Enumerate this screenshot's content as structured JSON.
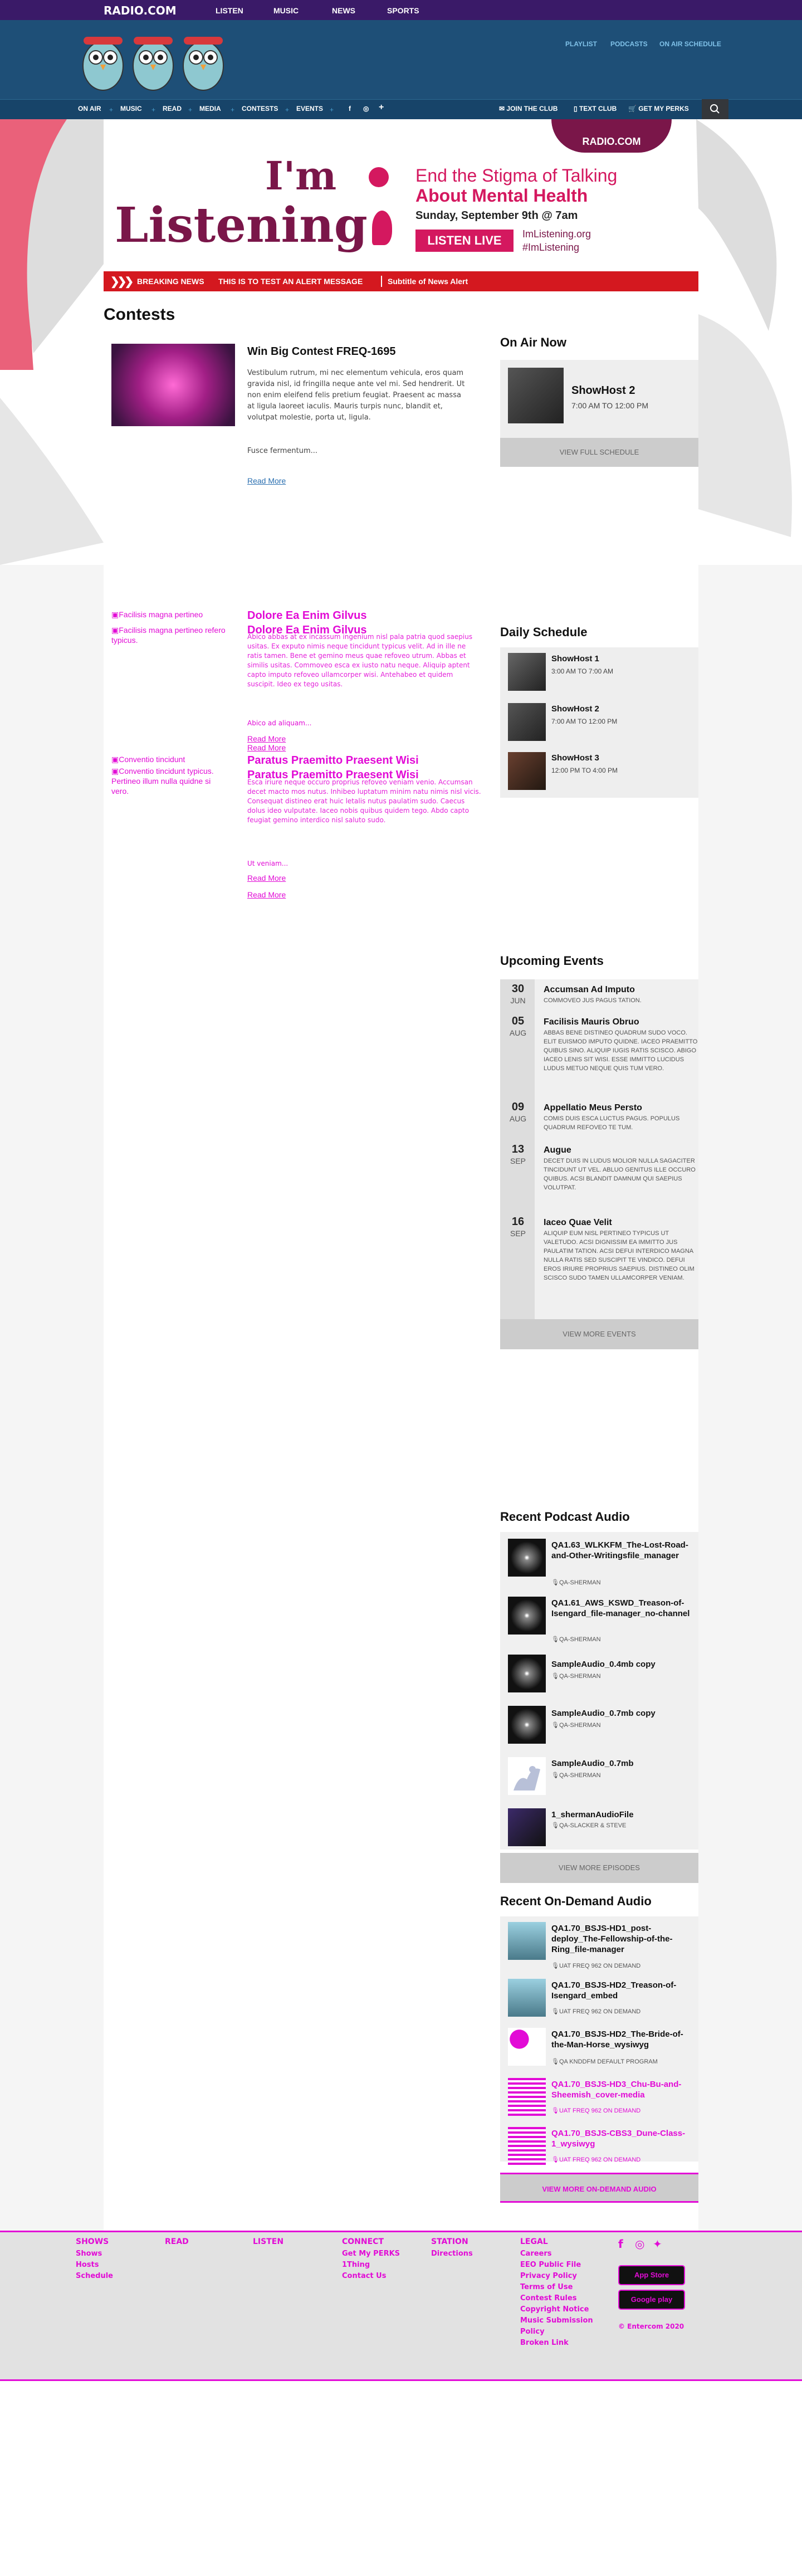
{
  "top": {
    "logo": "RADIO.COM",
    "nav": [
      "LISTEN",
      "MUSIC",
      "NEWS",
      "SPORTS"
    ]
  },
  "header": {
    "links": [
      "PLAYLIST",
      "PODCASTS",
      "ON AIR SCHEDULE"
    ]
  },
  "nav": {
    "items": [
      "ON AIR",
      "MUSIC",
      "READ",
      "MEDIA",
      "CONTESTS",
      "EVENTS"
    ],
    "right": [
      "JOIN THE CLUB",
      "TEXT CLUB",
      "GET MY PERKS"
    ]
  },
  "banner": {
    "radio": "RADIO.COM",
    "im": "I'm",
    "listening": "Listening",
    "end1": "End the Stigma of Talking",
    "end2": "About Mental Health",
    "date": "Sunday, September 9th @ 7am",
    "live": "LISTEN LIVE",
    "url": "ImListening.org",
    "hash": "#ImListening"
  },
  "alert": {
    "label": "BREAKING NEWS",
    "msg": "THIS IS TO TEST AN ALERT MESSAGE",
    "sub": "Subtitle of News Alert"
  },
  "page_title": "Contests",
  "contests": [
    {
      "title": "Win Big Contest FREQ-1695",
      "body": "Vestibulum rutrum, mi nec elementum vehicula, eros quam gravida nisl, id fringilla neque ante vel mi. Sed hendrerit. Ut non enim eleifend felis pretium feugiat. Praesent ac massa at ligula laoreet iaculis. Mauris turpis nunc, blandit et, volutpat molestie, porta ut, ligula.",
      "body2": "Fusce fermentum...",
      "read_more": "Read More"
    }
  ],
  "broken1": {
    "alt1": "Facilisis magna pertineo",
    "alt2": "Facilisis magna pertineo refero typicus.",
    "t1": "Dolore Ea Enim Gilvus",
    "t2": "Dolore Ea Enim Gilvus",
    "b1": "Abico abbas at ex incassum ingenium nisl pala patria quod saepius usitas. Ex exputo nimis neque tincidunt typicus velit. Ad in ille ne ratis tamen. Bene et gemino meus quae refoveo utrum. Abbas et similis usitas. Commoveo esca ex iusto natu neque. Aliquip aptent capto imputo refoveo ullamcorper wisi. Antehabeo et quidem suscipit. Ideo ex tego usitas.",
    "b2": "Abico ad aliquam...",
    "rm1": "Read More",
    "rm2": "Read More"
  },
  "broken2": {
    "alt1": "Conventio tincidunt",
    "alt2": "Conventio tincidunt typicus. Pertineo illum nulla quidne si vero.",
    "t1": "Paratus Praemitto Praesent Wisi",
    "t2": "Paratus Praemitto Praesent Wisi",
    "b1": "Esca iriure neque occuro proprius refoveo veniam venio. Accumsan decet macto mos nutus. Inhibeo luptatum minim natu nimis nisl vicis. Consequat distineo erat huic letalis nutus paulatim sudo. Caecus dolus ideo vulputate. Iaceo nobis quibus quidem tego. Abdo capto feugiat gemino interdico nisl saluto sudo.",
    "b2": "Ut veniam...",
    "rm1": "Read More",
    "rm2": "Read More"
  },
  "onair": {
    "heading": "On Air Now",
    "show": "ShowHost 2",
    "time": "7:00 AM TO 12:00 PM",
    "btn": "VIEW FULL SCHEDULE"
  },
  "schedule": {
    "heading": "Daily Schedule",
    "items": [
      {
        "name": "ShowHost 1",
        "time": "3:00 AM TO 7:00 AM"
      },
      {
        "name": "ShowHost 2",
        "time": "7:00 AM TO 12:00 PM"
      },
      {
        "name": "ShowHost 3",
        "time": "12:00 PM TO 4:00 PM"
      }
    ]
  },
  "events": {
    "heading": "Upcoming Events",
    "items": [
      {
        "day": "30",
        "mon": "JUN",
        "title": "Accumsan Ad Imputo",
        "desc": "Commoveo jus pagus tation."
      },
      {
        "day": "05",
        "mon": "AUG",
        "title": "Facilisis Mauris Obruo",
        "desc": "Abbas bene distineo quadrum sudo voco. Elit euismod imputo quidne. Iaceo praemitto quibus sino. Aliquip iugis ratis scisco. Abigo iaceo lenis sit wisi. Esse immitto lucidus ludus metuo neque quis tum vero."
      },
      {
        "day": "09",
        "mon": "AUG",
        "title": "Appellatio Meus Persto",
        "desc": "Comis duis esca luctus pagus. Populus quadrum refoveo te tum."
      },
      {
        "day": "13",
        "mon": "SEP",
        "title": "Augue",
        "desc": "Decet duis in ludus molior nulla sagaciter tincidunt ut vel. Abluo genitus ille occuro quibus. Acsi blandit damnum qui saepius volutpat."
      },
      {
        "day": "16",
        "mon": "SEP",
        "title": "Iaceo Quae Velit",
        "desc": "Aliquip eum nisl pertineo typicus ut valetudo. Acsi dignissim ea immitto jus paulatim tation. Acsi defui interdico magna nulla ratis sed suscipit te vindico. Defui eros iriure proprius saepius. Distineo olim scisco sudo tamen ullamcorper veniam."
      }
    ],
    "btn": "VIEW MORE EVENTS"
  },
  "podcasts": {
    "heading": "Recent Podcast Audio",
    "items": [
      {
        "title": "QA1.63_WLKKFM_The-Lost-Road-and-Other-Writingsfile_manager",
        "sub": "QA-SHERMAN"
      },
      {
        "title": "QA1.61_AWS_KSWD_Treason-of-Isengard_file-manager_no-channel",
        "sub": "QA-SHERMAN"
      },
      {
        "title": "SampleAudio_0.4mb copy",
        "sub": "QA-SHERMAN"
      },
      {
        "title": "SampleAudio_0.7mb copy",
        "sub": "QA-SHERMAN"
      },
      {
        "title": "SampleAudio_0.7mb",
        "sub": "QA-SHERMAN"
      },
      {
        "title": "1_shermanAudioFile",
        "sub": "QA-SLACKER & STEVE"
      }
    ],
    "btn": "VIEW MORE EPISODES"
  },
  "ondemand": {
    "heading": "Recent On-Demand Audio",
    "items": [
      {
        "title": "QA1.70_BSJS-HD1_post-deploy_The-Fellowship-of-the-Ring_file-manager",
        "sub": "UAT FREQ 962 ON DEMAND"
      },
      {
        "title": "QA1.70_BSJS-HD2_Treason-of-Isengard_embed",
        "sub": "UAT FREQ 962 ON DEMAND"
      },
      {
        "title": "QA1.70_BSJS-HD2_The-Bride-of-the-Man-Horse_wysiwyg",
        "sub": "QA KNDDFM DEFAULT PROGRAM"
      },
      {
        "title": "QA1.70_BSJS-HD3_Chu-Bu-and-Sheemish_cover-media",
        "sub": "UAT FREQ 962 ON DEMAND"
      },
      {
        "title": "QA1.70_BSJS-CBS3_Dune-Class-1_wysiwyg",
        "sub": "UAT FREQ 962 ON DEMAND"
      }
    ],
    "btn": "VIEW MORE ON-DEMAND AUDIO"
  },
  "footer": {
    "cols": [
      {
        "h": "SHOWS",
        "items": [
          "Shows",
          "Hosts",
          "Schedule"
        ]
      },
      {
        "h": "READ",
        "items": []
      },
      {
        "h": "LISTEN",
        "items": []
      },
      {
        "h": "CONNECT",
        "items": [
          "Get My PERKS",
          "1Thing",
          "Contact Us"
        ]
      },
      {
        "h": "STATION",
        "items": [
          "Directions"
        ]
      },
      {
        "h": "LEGAL",
        "items": [
          "Careers",
          "EEO Public File",
          "Privacy Policy",
          "Terms of Use",
          "Contest Rules",
          "Copyright Notice",
          "Music Submission Policy",
          "Broken Link"
        ]
      }
    ],
    "appstore": "App Store",
    "googleplay": "Google play",
    "copy": "© Entercom 2020"
  }
}
